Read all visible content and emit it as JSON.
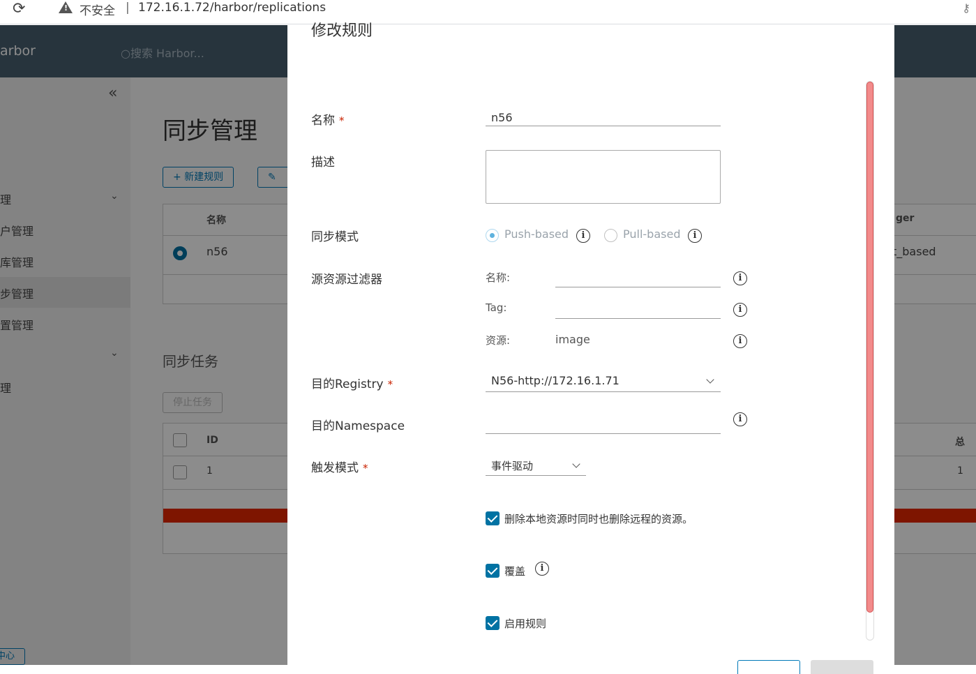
{
  "browser": {
    "reload_icon": "⟳",
    "security_text": "不安全",
    "separator": "|",
    "url": "172.16.1.72/harbor/replications"
  },
  "app": {
    "brand": "arbor",
    "search_placeholder": "搜索 Harbor...",
    "collapse_glyph": "«",
    "sidebar_items": [
      "理",
      "户管理",
      "库管理",
      "步管理",
      "置管理",
      "理"
    ],
    "bottom_button": "中心",
    "page_title": "同步管理",
    "new_rule_button": "+ 新建规则",
    "rules_grid": {
      "header_name": "名称",
      "header_trigger": "ger",
      "row_name": "n56",
      "row_trigger": "t_based"
    },
    "tasks_title": "同步任务",
    "stop_task_button": "停止任务",
    "tasks_grid": {
      "header_id": "ID",
      "header_total": "总",
      "row_id": "1",
      "row_total": "1"
    }
  },
  "modal": {
    "title": "修改规则",
    "name_label": "名称",
    "name_value": "n56",
    "description_label": "描述",
    "description_value": "",
    "sync_mode_label": "同步模式",
    "push_label": "Push-based",
    "pull_label": "Pull-based",
    "push_selected": true,
    "filter_label": "源资源过滤器",
    "filter_name_label": "名称:",
    "filter_name_value": "",
    "filter_tag_label": "Tag:",
    "filter_tag_value": "",
    "filter_resource_label": "资源:",
    "filter_resource_value": "image",
    "dest_registry_label": "目的Registry",
    "dest_registry_value": "N56-http://172.16.1.71",
    "dest_namespace_label": "目的Namespace",
    "dest_namespace_value": "",
    "trigger_label": "触发模式",
    "trigger_value": "事件驱动",
    "required_mark": "*",
    "info_glyph": "i",
    "delete_remote_label": "删除本地资源时同时也删除远程的资源。",
    "delete_remote_checked": true,
    "override_label": "覆盖",
    "override_checked": true,
    "enable_label": "启用规则",
    "enable_checked": true
  },
  "colors": {
    "nav_bg": "#485f70",
    "accent": "#0072a3",
    "required": "#c92100",
    "scroll_thumb": "#f28b8b"
  }
}
